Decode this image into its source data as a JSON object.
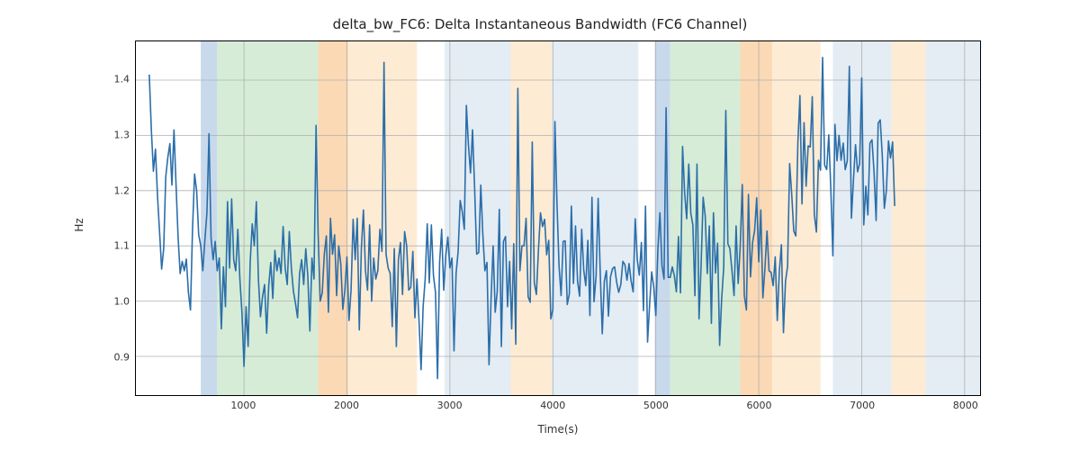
{
  "chart_data": {
    "type": "line",
    "title": "delta_bw_FC6: Delta Instantaneous Bandwidth (FC6 Channel)",
    "xlabel": "Time(s)",
    "ylabel": "Hz",
    "xlim": [
      -50,
      8150
    ],
    "ylim": [
      0.83,
      1.47
    ],
    "xticks": [
      1000,
      2000,
      3000,
      4000,
      5000,
      6000,
      7000,
      8000
    ],
    "yticks": [
      0.9,
      1.0,
      1.1,
      1.2,
      1.3,
      1.4
    ],
    "bands": [
      {
        "x0": 580,
        "x1": 740,
        "color": "#c9d9ec"
      },
      {
        "x0": 740,
        "x1": 1720,
        "color": "#d6ecd6"
      },
      {
        "x0": 1720,
        "x1": 2010,
        "color": "#fbd9b5"
      },
      {
        "x0": 2010,
        "x1": 2680,
        "color": "#feebd3"
      },
      {
        "x0": 2950,
        "x1": 3590,
        "color": "#e4ecf4"
      },
      {
        "x0": 3590,
        "x1": 3990,
        "color": "#feebd3"
      },
      {
        "x0": 3990,
        "x1": 4830,
        "color": "#e4ecf4"
      },
      {
        "x0": 4990,
        "x1": 5140,
        "color": "#c9d9ec"
      },
      {
        "x0": 5140,
        "x1": 5820,
        "color": "#d6ecd6"
      },
      {
        "x0": 5820,
        "x1": 6130,
        "color": "#fbd9b5"
      },
      {
        "x0": 6130,
        "x1": 6600,
        "color": "#feebd3"
      },
      {
        "x0": 6720,
        "x1": 7290,
        "color": "#e4ecf4"
      },
      {
        "x0": 7290,
        "x1": 7620,
        "color": "#feebd3"
      },
      {
        "x0": 7620,
        "x1": 8150,
        "color": "#e4ecf4"
      }
    ],
    "series": [
      {
        "name": "delta_bw_FC6",
        "color": "#2b6ea9",
        "x_step": 20,
        "x_start": 80,
        "values": [
          1.41,
          1.31,
          1.235,
          1.275,
          1.19,
          1.125,
          1.058,
          1.095,
          1.225,
          1.26,
          1.285,
          1.21,
          1.31,
          1.21,
          1.115,
          1.05,
          1.072,
          1.055,
          1.076,
          1.016,
          0.984,
          1.13,
          1.23,
          1.2,
          1.12,
          1.1,
          1.055,
          1.11,
          1.16,
          1.303,
          1.115,
          1.075,
          1.108,
          1.055,
          1.078,
          0.95,
          1.062,
          0.99,
          1.18,
          1.06,
          1.185,
          1.075,
          1.055,
          1.13,
          1.04,
          0.98,
          0.882,
          0.99,
          0.918,
          1.07,
          1.14,
          1.1,
          1.18,
          1.04,
          0.972,
          1.008,
          1.03,
          0.942,
          1.028,
          1.07,
          1.005,
          1.092,
          1.055,
          1.078,
          1.05,
          1.135,
          1.06,
          1.03,
          1.126,
          1.06,
          1.018,
          0.996,
          0.97,
          1.05,
          1.075,
          1.03,
          1.095,
          1.045,
          0.946,
          1.078,
          1.04,
          1.318,
          1.122,
          1.0,
          1.015,
          1.085,
          1.118,
          0.98,
          1.15,
          1.085,
          1.12,
          1.01,
          1.1,
          1.068,
          0.985,
          1.02,
          1.08,
          0.965,
          1.02,
          1.148,
          1.075,
          1.15,
          0.948,
          1.095,
          1.165,
          1.055,
          1.02,
          1.138,
          1.0,
          1.078,
          1.04,
          1.055,
          1.13,
          1.09,
          1.432,
          1.085,
          1.06,
          1.05,
          0.954,
          1.095,
          0.918,
          1.075,
          1.106,
          1.012,
          1.126,
          1.1,
          1.02,
          1.025,
          1.09,
          0.97,
          1.04,
          0.965,
          0.876,
          0.99,
          1.04,
          1.14,
          1.033,
          1.138,
          1.047,
          1.016,
          0.86,
          1.07,
          1.13,
          1.02,
          1.083,
          1.116,
          1.06,
          1.078,
          0.91,
          1.05,
          1.09,
          1.182,
          1.162,
          1.13,
          1.354,
          1.283,
          1.232,
          1.31,
          1.205,
          1.085,
          1.088,
          1.21,
          1.12,
          1.055,
          1.07,
          0.885,
          1.004,
          1.1,
          0.98,
          1.018,
          1.166,
          0.918,
          1.108,
          1.117,
          0.99,
          1.072,
          0.95,
          1.104,
          0.922,
          1.385,
          1.055,
          1.1,
          1.1,
          1.15,
          1.008,
          0.998,
          1.288,
          1.033,
          1.012,
          1.092,
          1.16,
          1.135,
          1.148,
          1.084,
          1.11,
          0.968,
          0.984,
          1.325,
          1.178,
          1.064,
          1.01,
          1.108,
          1.109,
          0.994,
          1.013,
          1.172,
          1.032,
          1.136,
          1.036,
          1.009,
          1.13,
          1.056,
          1.028,
          1.11,
          0.974,
          1.188,
          0.999,
          1.045,
          1.186,
          1.053,
          0.941,
          1.036,
          1.055,
          0.973,
          1.044,
          1.059,
          1.062,
          1.034,
          1.016,
          1.03,
          1.072,
          1.066,
          1.038,
          1.068,
          1.037,
          1.017,
          1.149,
          1.075,
          1.047,
          1.106,
          0.983,
          1.172,
          0.926,
          0.994,
          1.053,
          1.025,
          0.974,
          1.093,
          1.16,
          1.064,
          1.04,
          1.35,
          1.043,
          1.043,
          1.062,
          1.046,
          1.017,
          1.117,
          1.015,
          1.28,
          1.196,
          1.149,
          1.248,
          1.159,
          1.138,
          1.01,
          1.248,
          0.968,
          1.065,
          1.188,
          1.154,
          1.05,
          1.136,
          0.96,
          1.16,
          1.051,
          1.105,
          0.92,
          1.005,
          1.062,
          1.345,
          1.104,
          1.095,
          1.055,
          1.01,
          1.136,
          1.032,
          1.099,
          1.211,
          1.01,
          0.984,
          1.193,
          1.044,
          1.106,
          1.128,
          1.187,
          1.071,
          1.165,
          1.006,
          1.059,
          1.127,
          1.055,
          1.052,
          1.028,
          1.08,
          0.965,
          1.054,
          1.102,
          0.943,
          1.036,
          1.063,
          1.249,
          1.194,
          1.127,
          1.118,
          1.287,
          1.372,
          1.176,
          1.323,
          1.208,
          1.281,
          1.279,
          1.37,
          1.156,
          1.125,
          1.255,
          1.237,
          1.441,
          1.246,
          1.238,
          1.301,
          1.203,
          1.082,
          1.32,
          1.254,
          1.3,
          1.255,
          1.286,
          1.238,
          1.254,
          1.425,
          1.15,
          1.22,
          1.283,
          1.234,
          1.249,
          1.404,
          1.138,
          1.208,
          1.156,
          1.286,
          1.292,
          1.233,
          1.146,
          1.322,
          1.328,
          1.263,
          1.168,
          1.201,
          1.29,
          1.259,
          1.288,
          1.172
        ]
      }
    ]
  }
}
